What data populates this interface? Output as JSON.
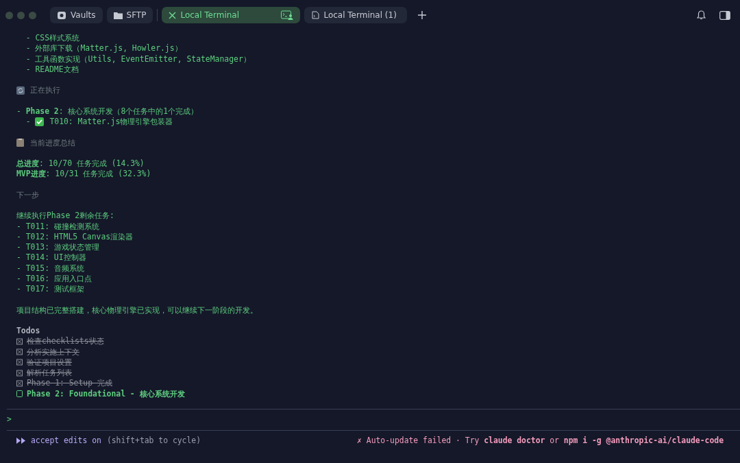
{
  "tabs": [
    {
      "kind": "vaults",
      "label": "Vaults",
      "selected": false
    },
    {
      "kind": "sftp",
      "label": "SFTP",
      "selected": false
    },
    {
      "kind": "terminal",
      "label": "Local Terminal",
      "selected": true
    },
    {
      "kind": "terminal",
      "label": "Local Terminal (1)",
      "selected": false
    }
  ],
  "lines": [
    {
      "kind": "text",
      "text": "  - CSS样式系统"
    },
    {
      "kind": "text",
      "text": "  - 外部库下载（Matter.js, Howler.js）"
    },
    {
      "kind": "text",
      "text": "  - 工具函数实现（Utils, EventEmitter, StateManager）"
    },
    {
      "kind": "text",
      "text": "  - README文档"
    },
    {
      "kind": "blank"
    },
    {
      "kind": "heading_running",
      "text": "正在执行"
    },
    {
      "kind": "blank"
    },
    {
      "kind": "text",
      "text": "- **Phase 2**: 核心系统开发（8个任务中的1个完成）"
    },
    {
      "kind": "done_item",
      "prefix": "  - ",
      "text": "T010: Matter.js物理引擎包装器"
    },
    {
      "kind": "blank"
    },
    {
      "kind": "heading_summary",
      "text": "当前进度总结"
    },
    {
      "kind": "blank"
    },
    {
      "kind": "text",
      "text": "**总进度**: 10/70 任务完成 (14.3%)"
    },
    {
      "kind": "text",
      "text": "**MVP进度**: 10/31 任务完成 (32.3%)"
    },
    {
      "kind": "blank"
    },
    {
      "kind": "heading",
      "text": "下一步"
    },
    {
      "kind": "blank"
    },
    {
      "kind": "text",
      "text": "继续执行Phase 2剩余任务:"
    },
    {
      "kind": "text",
      "text": "- T011: 碰撞检测系统"
    },
    {
      "kind": "text",
      "text": "- T012: HTML5 Canvas渲染器"
    },
    {
      "kind": "text",
      "text": "- T013: 游戏状态管理"
    },
    {
      "kind": "text",
      "text": "- T014: UI控制器"
    },
    {
      "kind": "text",
      "text": "- T015: 音频系统"
    },
    {
      "kind": "text",
      "text": "- T016: 应用入口点"
    },
    {
      "kind": "text",
      "text": "- T017: 测试框架"
    },
    {
      "kind": "blank"
    },
    {
      "kind": "text",
      "text": "项目结构已完整搭建，核心物理引擎已实现，可以继续下一阶段的开发。"
    },
    {
      "kind": "blank"
    },
    {
      "kind": "todos_title",
      "text": "Todos"
    },
    {
      "kind": "todo",
      "checked": true,
      "text": "检查checklists状态"
    },
    {
      "kind": "todo",
      "checked": true,
      "text": "分析实施上下文"
    },
    {
      "kind": "todo",
      "checked": true,
      "text": "验证项目设置"
    },
    {
      "kind": "todo",
      "checked": true,
      "text": "解析任务列表"
    },
    {
      "kind": "todo",
      "checked": true,
      "text": "Phase 1: Setup 完成"
    },
    {
      "kind": "todo",
      "checked": false,
      "text": "Phase 2: Foundational - 核心系统开发"
    }
  ],
  "prompt": ">",
  "status": {
    "mode": "accept edits on",
    "hint": "(shift+tab to cycle)",
    "error": "✗ Auto-update failed · Try **claude doctor** or **npm i -g @anthropic-ai/claude-code**"
  }
}
